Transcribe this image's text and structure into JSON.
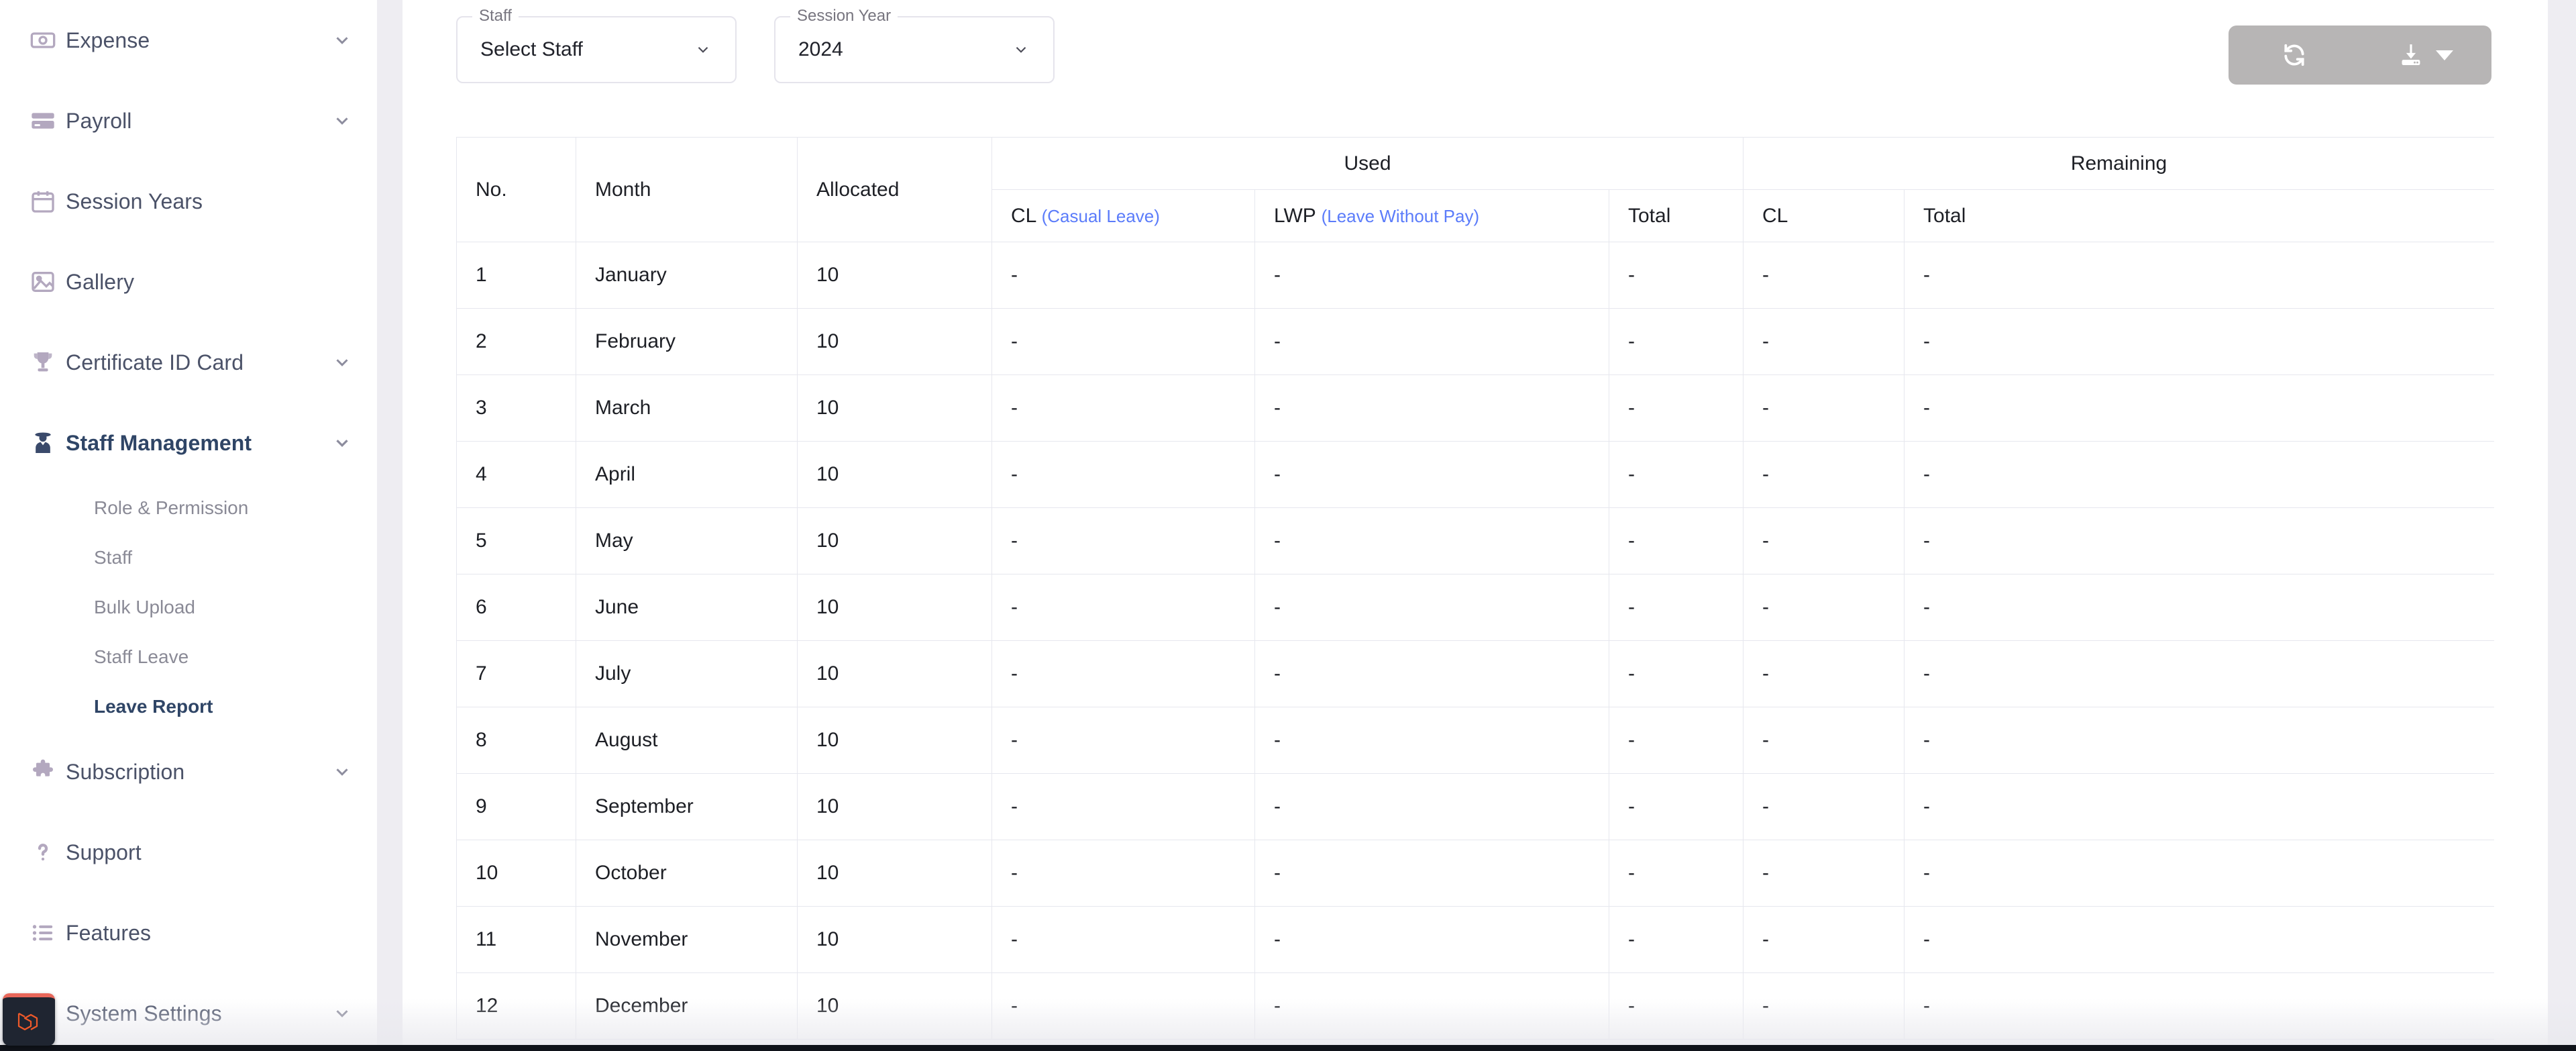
{
  "sidebar": {
    "items": [
      {
        "label": "Expense",
        "icon": "banknote-icon",
        "expandable": true,
        "active": false
      },
      {
        "label": "Payroll",
        "icon": "credit-card-icon",
        "expandable": true,
        "active": false
      },
      {
        "label": "Session Years",
        "icon": "calendar-icon",
        "expandable": false,
        "active": false
      },
      {
        "label": "Gallery",
        "icon": "image-icon",
        "expandable": false,
        "active": false
      },
      {
        "label": "Certificate ID Card",
        "icon": "trophy-icon",
        "expandable": true,
        "active": false
      },
      {
        "label": "Staff Management",
        "icon": "staff-icon",
        "expandable": true,
        "active": true
      }
    ],
    "submenu": [
      {
        "label": "Role & Permission",
        "active": false
      },
      {
        "label": "Staff",
        "active": false
      },
      {
        "label": "Bulk Upload",
        "active": false
      },
      {
        "label": "Staff Leave",
        "active": false
      },
      {
        "label": "Leave Report",
        "active": true
      }
    ],
    "items_after": [
      {
        "label": "Subscription",
        "icon": "puzzle-icon",
        "expandable": true,
        "active": false
      },
      {
        "label": "Support",
        "icon": "question-icon",
        "expandable": false,
        "active": false
      },
      {
        "label": "Features",
        "icon": "list-icon",
        "expandable": false,
        "active": false
      },
      {
        "label": "System Settings",
        "icon": "gear-icon",
        "expandable": true,
        "active": false
      }
    ],
    "debugbar_icon": "laravel-logo-icon"
  },
  "toolbar": {
    "staff_filter": {
      "label": "Staff",
      "value": "Select Staff",
      "caret_icon": "chevron-down-icon"
    },
    "session_year_filter": {
      "label": "Session Year",
      "value": "2024",
      "caret_icon": "chevron-down-icon"
    },
    "refresh_button": {
      "icon": "refresh-icon",
      "label": ""
    },
    "download_button": {
      "icon": "download-icon",
      "label": "",
      "caret_icon": "caret-down-icon"
    },
    "button_group_color": "#b7b5b5"
  },
  "table": {
    "group_headers": {
      "used": "Used",
      "remaining": "Remaining"
    },
    "columns": {
      "no": "No.",
      "month": "Month",
      "allocated": "Allocated",
      "used_cl_abbr": "CL",
      "used_cl_expand": "(Casual Leave)",
      "used_lwp_abbr": "LWP",
      "used_lwp_expand": "(Leave Without Pay)",
      "used_total": "Total",
      "remaining_cl": "CL",
      "remaining_total": "Total"
    },
    "accent_expand_color": "#5b7cfa",
    "rows": [
      {
        "no": "1",
        "month": "January",
        "allocated": "10",
        "used_cl": "-",
        "used_lwp": "-",
        "used_total": "-",
        "rem_cl": "-",
        "rem_total": "-"
      },
      {
        "no": "2",
        "month": "February",
        "allocated": "10",
        "used_cl": "-",
        "used_lwp": "-",
        "used_total": "-",
        "rem_cl": "-",
        "rem_total": "-"
      },
      {
        "no": "3",
        "month": "March",
        "allocated": "10",
        "used_cl": "-",
        "used_lwp": "-",
        "used_total": "-",
        "rem_cl": "-",
        "rem_total": "-"
      },
      {
        "no": "4",
        "month": "April",
        "allocated": "10",
        "used_cl": "-",
        "used_lwp": "-",
        "used_total": "-",
        "rem_cl": "-",
        "rem_total": "-"
      },
      {
        "no": "5",
        "month": "May",
        "allocated": "10",
        "used_cl": "-",
        "used_lwp": "-",
        "used_total": "-",
        "rem_cl": "-",
        "rem_total": "-"
      },
      {
        "no": "6",
        "month": "June",
        "allocated": "10",
        "used_cl": "-",
        "used_lwp": "-",
        "used_total": "-",
        "rem_cl": "-",
        "rem_total": "-"
      },
      {
        "no": "7",
        "month": "July",
        "allocated": "10",
        "used_cl": "-",
        "used_lwp": "-",
        "used_total": "-",
        "rem_cl": "-",
        "rem_total": "-"
      },
      {
        "no": "8",
        "month": "August",
        "allocated": "10",
        "used_cl": "-",
        "used_lwp": "-",
        "used_total": "-",
        "rem_cl": "-",
        "rem_total": "-"
      },
      {
        "no": "9",
        "month": "September",
        "allocated": "10",
        "used_cl": "-",
        "used_lwp": "-",
        "used_total": "-",
        "rem_cl": "-",
        "rem_total": "-"
      },
      {
        "no": "10",
        "month": "October",
        "allocated": "10",
        "used_cl": "-",
        "used_lwp": "-",
        "used_total": "-",
        "rem_cl": "-",
        "rem_total": "-"
      },
      {
        "no": "11",
        "month": "November",
        "allocated": "10",
        "used_cl": "-",
        "used_lwp": "-",
        "used_total": "-",
        "rem_cl": "-",
        "rem_total": "-"
      },
      {
        "no": "12",
        "month": "December",
        "allocated": "10",
        "used_cl": "-",
        "used_lwp": "-",
        "used_total": "-",
        "rem_cl": "-",
        "rem_total": "-"
      }
    ]
  }
}
